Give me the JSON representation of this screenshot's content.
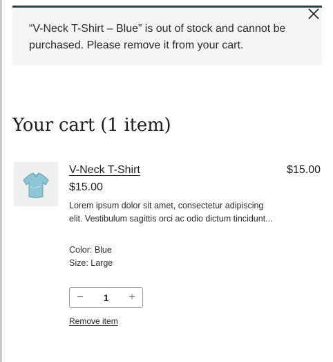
{
  "notice": {
    "message": "“V-Neck T-Shirt – Blue” is out of stock and cannot be purchased. Please remove it from your cart.",
    "close_icon": "close-icon",
    "accent_color": "#25413f",
    "background_color": "#f4f5f4"
  },
  "cart": {
    "title": "Your cart (1 item)",
    "items": [
      {
        "thumbnail_icon": "t-shirt-image",
        "name": "V-Neck T-Shirt",
        "unit_price": "$15.00",
        "description": "Lorem ipsum dolor sit amet, consectetur adipiscing elit. Vestibulum sagittis orci ac odio dictum tincidunt...",
        "color_label": "Color: Blue",
        "size_label": "Size: Large",
        "quantity": "1",
        "decrease_symbol": "−",
        "increase_symbol": "+",
        "remove_label": "Remove item",
        "line_total": "$15.00"
      }
    ]
  }
}
